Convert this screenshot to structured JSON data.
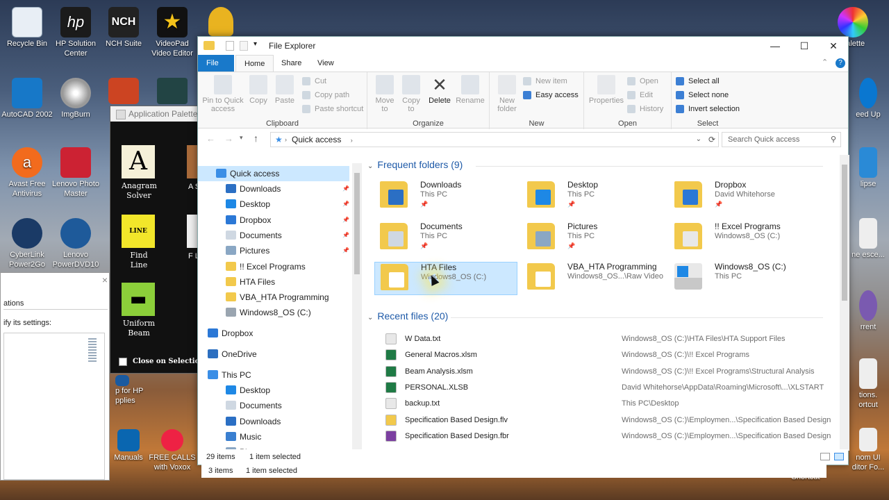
{
  "desktop": {
    "icons": [
      {
        "label": "Recycle Bin",
        "color": "#e8eef5"
      },
      {
        "label": "HP Solution Center",
        "color": "#1b1b1b"
      },
      {
        "label": "NCH Suite",
        "color": "#222"
      },
      {
        "label": "VideoPad Video Editor",
        "color": "#111"
      },
      {
        "label": "AutoCAD 2002",
        "color": "#1778c8"
      },
      {
        "label": "ImgBurn",
        "color": "#888"
      },
      {
        "label": "Avast Free Antivirus",
        "color": "#f26b1d"
      },
      {
        "label": "Lenovo Photo Master",
        "color": "#c23"
      },
      {
        "label": "CyberLink Power2Go",
        "color": "#1a3a66"
      },
      {
        "label": "Lenovo PowerDVD10",
        "color": "#1e5a9a"
      },
      {
        "label": "Manuals",
        "color": "#0a66b0"
      },
      {
        "label": "FREE CALLS with Voxox",
        "color": "#e24"
      },
      {
        "label": "p for HP pplies",
        "color": "#1a5aa0"
      },
      {
        "label": "Palette",
        "color": "#e33"
      },
      {
        "label": "eed Up",
        "color": "#0a77d0"
      },
      {
        "label": "lipse",
        "color": "#2a8ad6"
      },
      {
        "label": "ne esce...",
        "color": "#ddd"
      },
      {
        "label": "rrent",
        "color": "#7a5ab0"
      },
      {
        "label": "tions. ortcut",
        "color": "#ddd"
      },
      {
        "label": "nom UI ditor Fo...",
        "color": "#ddd"
      },
      {
        "label": "Shortcut",
        "color": "#ddd"
      }
    ]
  },
  "back_window": {
    "tab_label": "ations",
    "text": "ify its settings:",
    "close": "×"
  },
  "palette": {
    "title": "Application Palette",
    "tools": [
      {
        "label": "Anagram Solver",
        "glyph": "A",
        "bg": "#f5f0d8",
        "fg": "#000"
      },
      {
        "label": "Find Line",
        "glyph": "LINE",
        "bg": "#f2e62a",
        "fg": "#000"
      },
      {
        "label": "Uniform Beam",
        "glyph": "▬",
        "bg": "#8ccf3a",
        "fg": "#000"
      }
    ],
    "close_on_selection": "Close on Selection",
    "partial": [
      "A Sp",
      "F L"
    ]
  },
  "explorer": {
    "title": "File Explorer",
    "window_buttons": {
      "minimize": "—",
      "maximize": "☐",
      "close": "✕"
    },
    "tabs": [
      "File",
      "Home",
      "Share",
      "View"
    ],
    "active_tab": "Home",
    "ribbon": {
      "clipboard": {
        "label": "Clipboard",
        "pin": "Pin to Quick access",
        "copy": "Copy",
        "paste": "Paste",
        "cut": "Cut",
        "copy_path": "Copy path",
        "paste_shortcut": "Paste shortcut"
      },
      "organize": {
        "label": "Organize",
        "move_to": "Move to",
        "copy_to": "Copy to",
        "delete": "Delete",
        "rename": "Rename"
      },
      "new": {
        "label": "New",
        "new_folder": "New folder",
        "new_item": "New item",
        "easy_access": "Easy access"
      },
      "open": {
        "label": "Open",
        "properties": "Properties",
        "open": "Open",
        "edit": "Edit",
        "history": "History"
      },
      "select": {
        "label": "Select",
        "select_all": "Select all",
        "select_none": "Select none",
        "invert": "Invert selection"
      }
    },
    "address": {
      "path": "Quick access",
      "search_placeholder": "Search Quick access"
    },
    "nav": {
      "items": [
        {
          "label": "Quick access",
          "pinned": false,
          "selected": true,
          "color": "#3a8ee6"
        },
        {
          "label": "Downloads",
          "pinned": true,
          "color": "#2b6fc4"
        },
        {
          "label": "Desktop",
          "pinned": true,
          "color": "#1e88e5"
        },
        {
          "label": "Dropbox",
          "pinned": true,
          "color": "#2b78d6"
        },
        {
          "label": "Documents",
          "pinned": true,
          "color": "#cfd8e2"
        },
        {
          "label": "Pictures",
          "pinned": true,
          "color": "#8aa7c4"
        },
        {
          "label": "!! Excel Programs",
          "pinned": false,
          "color": "#f2c94c"
        },
        {
          "label": "HTA Files",
          "pinned": false,
          "color": "#f2c94c"
        },
        {
          "label": "VBA_HTA Programming",
          "pinned": false,
          "color": "#f2c94c"
        },
        {
          "label": "Windows8_OS (C:)",
          "pinned": false,
          "color": "#9aa5b0"
        },
        {
          "label": "Dropbox",
          "pinned": false,
          "color": "#2b78d6"
        },
        {
          "label": "OneDrive",
          "pinned": false,
          "color": "#2c6fc0"
        },
        {
          "label": "This PC",
          "pinned": false,
          "color": "#3a8ee6"
        },
        {
          "label": "Desktop",
          "pinned": false,
          "color": "#1e88e5"
        },
        {
          "label": "Documents",
          "pinned": false,
          "color": "#cfd8e2"
        },
        {
          "label": "Downloads",
          "pinned": false,
          "color": "#2b6fc4"
        },
        {
          "label": "Music",
          "pinned": false,
          "color": "#3a7fd0"
        },
        {
          "label": "Pictures",
          "pinned": false,
          "color": "#8aa7c4"
        }
      ],
      "pin_glyph": "📌"
    },
    "frequent": {
      "header": "Frequent folders (9)",
      "items": [
        {
          "name": "Downloads",
          "loc": "This PC",
          "pinned": true,
          "accent": "#2b6fc4"
        },
        {
          "name": "Desktop",
          "loc": "This PC",
          "pinned": true,
          "accent": "#1e88e5"
        },
        {
          "name": "Dropbox",
          "loc": "David Whitehorse",
          "pinned": true,
          "accent": "#2b78d6"
        },
        {
          "name": "Documents",
          "loc": "This PC",
          "pinned": true,
          "accent": "#cfd8e2"
        },
        {
          "name": "Pictures",
          "loc": "This PC",
          "pinned": true,
          "accent": "#8aa7c4"
        },
        {
          "name": "!! Excel Programs",
          "loc": "Windows8_OS (C:)",
          "pinned": false,
          "accent": "#e8e8e8"
        },
        {
          "name": "HTA Files",
          "loc": "Windows8_OS (C:)",
          "pinned": false,
          "accent": "#ffffff",
          "selected": true
        },
        {
          "name": "VBA_HTA Programming",
          "loc": "Windows8_OS...\\Raw Video",
          "pinned": false,
          "accent": "#ffffff"
        },
        {
          "name": "Windows8_OS (C:)",
          "loc": "This PC",
          "pinned": false,
          "accent": "#1e88e5",
          "drive": true
        }
      ]
    },
    "recent": {
      "header": "Recent files (20)",
      "items": [
        {
          "name": "W Data.txt",
          "path": "Windows8_OS (C:)\\HTA Files\\HTA Support Files",
          "color": "#e8e8e8"
        },
        {
          "name": "General Macros.xlsm",
          "path": "Windows8_OS (C:)\\!! Excel Programs",
          "color": "#1f7a45"
        },
        {
          "name": "Beam Analysis.xlsm",
          "path": "Windows8_OS (C:)\\!! Excel Programs\\Structural Analysis",
          "color": "#1f7a45"
        },
        {
          "name": "PERSONAL.XLSB",
          "path": "David Whitehorse\\AppData\\Roaming\\Microsoft\\...\\XLSTART",
          "color": "#1f7a45"
        },
        {
          "name": "backup.txt",
          "path": "This PC\\Desktop",
          "color": "#e8e8e8"
        },
        {
          "name": "Specification Based Design.flv",
          "path": "Windows8_OS (C:)\\Employmen...\\Specification Based Design",
          "color": "#f2c94c"
        },
        {
          "name": "Specification Based Design.fbr",
          "path": "Windows8_OS (C:)\\Employmen...\\Specification Based Design",
          "color": "#7b3fa0"
        }
      ]
    },
    "status": {
      "count": "29 items",
      "selected": "1 item selected"
    }
  },
  "bottom_status": {
    "count": "3 items",
    "selected": "1 item selected"
  }
}
